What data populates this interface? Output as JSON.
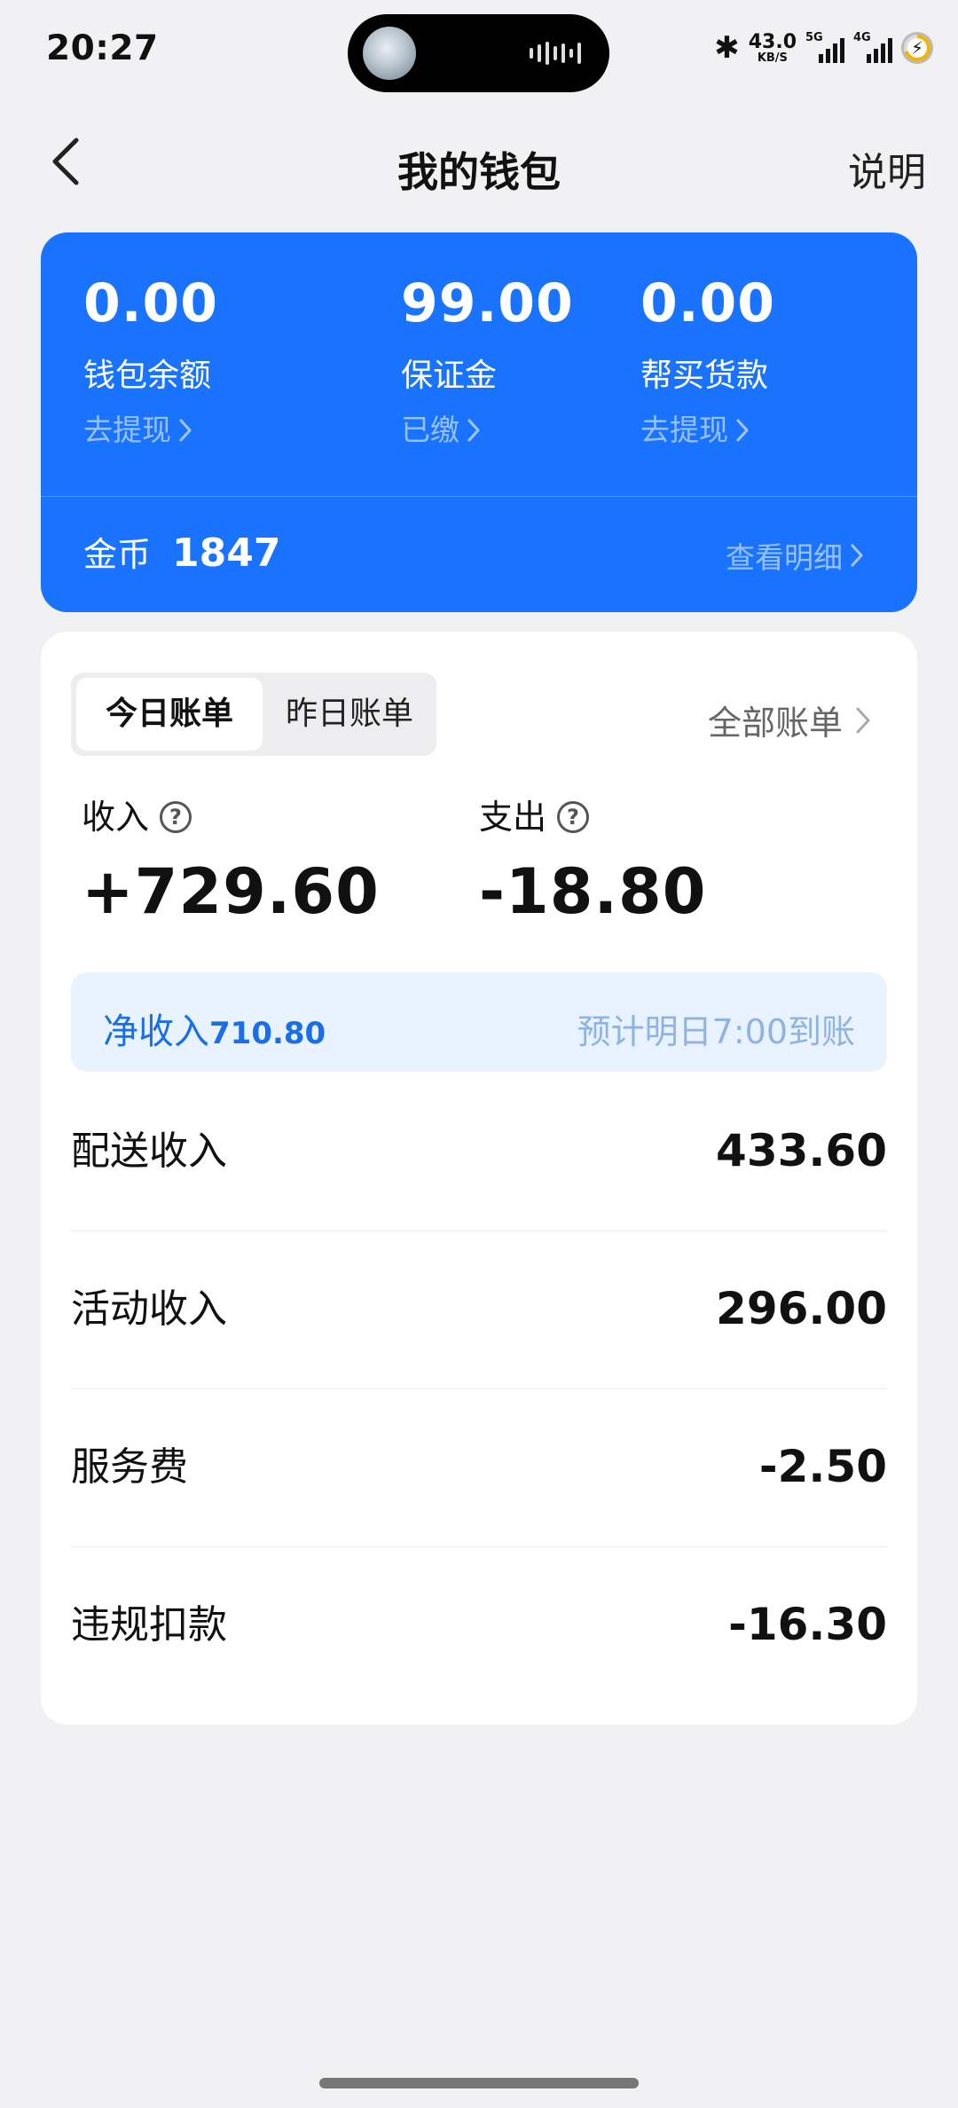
{
  "status_bar": {
    "time": "20:27",
    "net_speed_value": "43.0",
    "net_speed_unit": "KB/S",
    "sim1_label": "5G",
    "sim2_label": "4G"
  },
  "nav": {
    "title": "我的钱包",
    "help_label": "说明"
  },
  "wallet": {
    "balance": {
      "amount": "0.00",
      "label": "钱包余额",
      "action": "去提现"
    },
    "deposit": {
      "amount": "99.00",
      "label": "保证金",
      "action": "已缴"
    },
    "purchase": {
      "amount": "0.00",
      "label": "帮买货款",
      "action": "去提现"
    },
    "coins_label": "金币",
    "coins_value": "1847",
    "detail_label": "查看明细"
  },
  "bills": {
    "tabs": [
      "今日账单",
      "昨日账单"
    ],
    "active_tab": "今日账单",
    "all_bills_label": "全部账单",
    "income_label": "收入",
    "income_value": "+729.60",
    "expense_label": "支出",
    "expense_value": "-18.80",
    "net_label": "净收入",
    "net_value": "710.80",
    "eta_text": "预计明日7:00到账",
    "items": [
      {
        "name": "配送收入",
        "amount": "433.60"
      },
      {
        "name": "活动收入",
        "amount": "296.00"
      },
      {
        "name": "服务费",
        "amount": "-2.50"
      },
      {
        "name": "违规扣款",
        "amount": "-16.30"
      }
    ]
  },
  "colors": {
    "accent": "#1a73ff",
    "net_bg": "#e8f3ff",
    "net_text": "#1a6fe8"
  }
}
